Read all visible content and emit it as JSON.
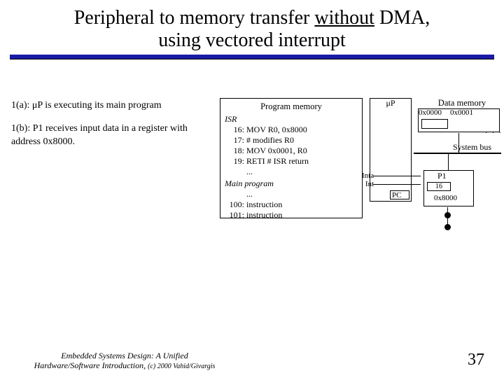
{
  "title": {
    "l1_a": "Peripheral to memory transfer ",
    "without": "without",
    "l1_b": " DMA,",
    "l2": "using vectored interrupt"
  },
  "left": {
    "p1": "1(a): μP is executing its main program",
    "p2": "1(b): P1 receives input data in a register with address 0x8000."
  },
  "progmem": {
    "title": "Program memory",
    "isr": "ISR",
    "l16": {
      "addr": "16:",
      "txt": "MOV R0, 0x8000"
    },
    "l17": {
      "addr": "17:",
      "txt": "# modifies R0"
    },
    "l18": {
      "addr": "18:",
      "txt": "MOV 0x0001, R0"
    },
    "l19": {
      "addr": "19:",
      "txt": "RETI  # ISR return"
    },
    "dots1": "...",
    "main": "Main program",
    "dots2": "...",
    "l100": {
      "addr": "100:",
      "txt": "instruction"
    },
    "l101": {
      "addr": "101:",
      "txt": "instruction"
    }
  },
  "up": {
    "label": "μP",
    "pc": "PC",
    "inta": "Inta",
    "int": "Int"
  },
  "dmem": {
    "title": "Data memory",
    "a0": "0x0000",
    "a1": "0x0001",
    "dots": "· · ·"
  },
  "bus": {
    "label": "System bus"
  },
  "p1": {
    "title": "P1",
    "inner": "16",
    "addr": "0x8000"
  },
  "footer": {
    "line1": "Embedded Systems Design: A Unified",
    "line2a": "Hardware/Software Introduction, ",
    "line2b": "(c) 2000 Vahid/Givargis"
  },
  "page": "37"
}
